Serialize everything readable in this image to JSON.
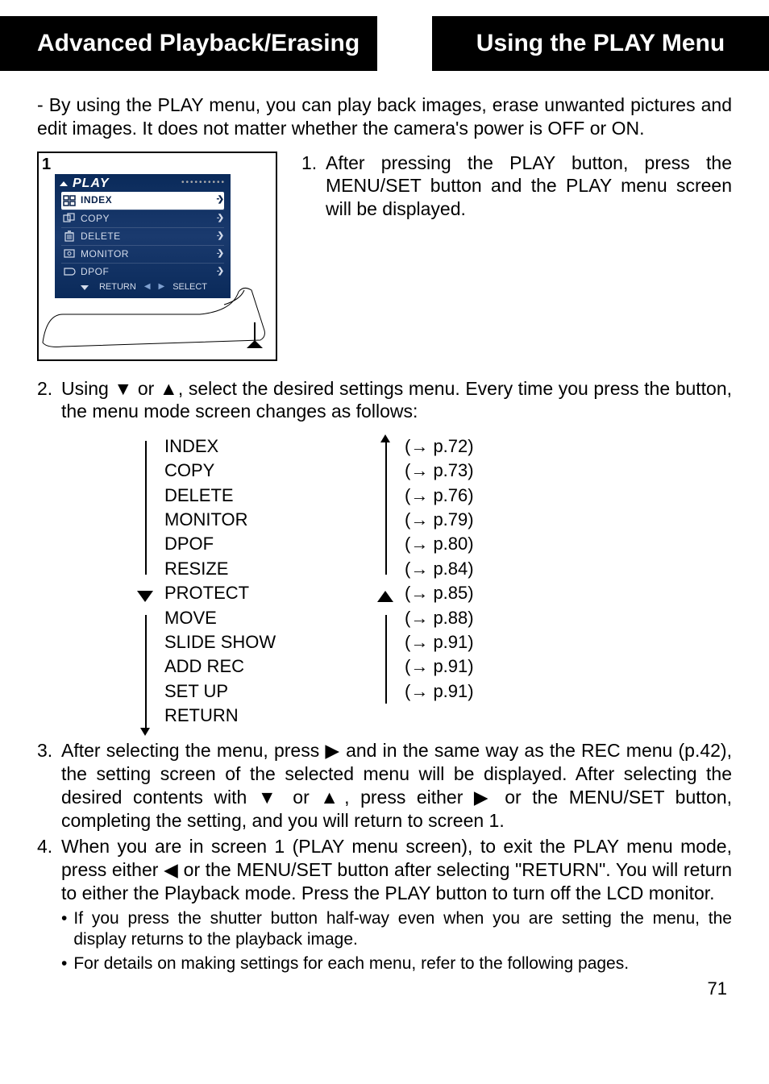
{
  "header": {
    "left": "Advanced Playback/Erasing",
    "right": "Using the PLAY Menu"
  },
  "intro": "By using the PLAY menu, you can play back images, erase unwanted pictures and edit images. It does not matter whether the camera's power is OFF or ON.",
  "screenshot": {
    "number": "1",
    "title": "PLAY",
    "items": [
      {
        "label": "INDEX",
        "selected": true
      },
      {
        "label": "COPY",
        "selected": false
      },
      {
        "label": "DELETE",
        "selected": false
      },
      {
        "label": "MONITOR",
        "selected": false
      },
      {
        "label": "DPOF",
        "selected": false
      }
    ],
    "footer": {
      "return": "RETURN",
      "select": "SELECT"
    }
  },
  "step1": {
    "num": "1.",
    "text": "After pressing the PLAY button, press the MENU/SET button and the PLAY menu screen will be displayed."
  },
  "step2": {
    "num": "2.",
    "text_a": "Using ",
    "text_b": " or ",
    "text_c": ", select the desired settings menu. Every time you press the button, the menu mode screen changes as follows:"
  },
  "menu_list": [
    {
      "name": "INDEX",
      "page": "(→ p.72)"
    },
    {
      "name": "COPY",
      "page": "(→ p.73)"
    },
    {
      "name": "DELETE",
      "page": "(→ p.76)"
    },
    {
      "name": "MONITOR",
      "page": "(→ p.79)"
    },
    {
      "name": "DPOF",
      "page": "(→ p.80)"
    },
    {
      "name": "RESIZE",
      "page": "(→ p.84)"
    },
    {
      "name": "PROTECT",
      "page": "(→ p.85)"
    },
    {
      "name": "MOVE",
      "page": "(→ p.88)"
    },
    {
      "name": "SLIDE SHOW",
      "page": "(→ p.91)"
    },
    {
      "name": "ADD REC",
      "page": "(→ p.91)"
    },
    {
      "name": "SET UP",
      "page": "(→ p.91)"
    },
    {
      "name": "RETURN",
      "page": ""
    }
  ],
  "step3": {
    "num": "3.",
    "a": "After selecting the menu, press ",
    "b": " and in the same way as the REC menu (p.42), the setting screen of the selected menu will be displayed.  After selecting the desired contents with ",
    "c": " or ",
    "d": ", press either ",
    "e": " or the MENU/SET button, completing the setting, and you will return to screen 1."
  },
  "step4": {
    "num": "4.",
    "a": "When you are in screen 1 (PLAY menu screen), to exit the PLAY menu mode, press either ",
    "b": " or the MENU/SET button after selecting \"RETURN\". You will return to either the Playback mode.  Press the PLAY button to turn off the LCD monitor."
  },
  "notes": [
    "If you press the shutter button half-way even when you are setting the menu, the display returns to the playback image.",
    "For details on making settings for each menu, refer to the following pages."
  ],
  "page_number": "71",
  "glyphs": {
    "down": "▼",
    "up": "▲",
    "right": "▶",
    "left": "◀",
    "bullet": "•"
  }
}
